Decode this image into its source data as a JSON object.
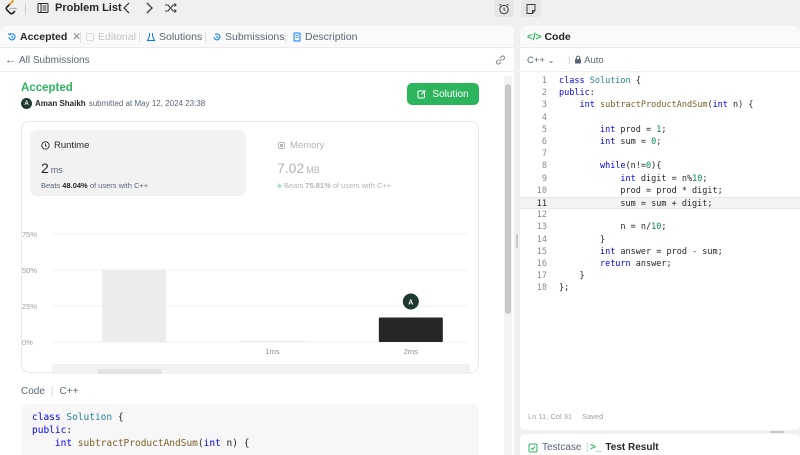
{
  "topbar": {
    "title": "Problem List",
    "icons": [
      "leetcode-logo",
      "list-icon",
      "chevron-left-icon",
      "chevron-right-icon",
      "shuffle-icon",
      "alarm-icon",
      "note-icon"
    ]
  },
  "left_tabs": [
    {
      "label": "Accepted",
      "icon": "history-icon",
      "active": true
    },
    {
      "label": "Editorial",
      "icon": "book-icon",
      "disabled": true
    },
    {
      "label": "Solutions",
      "icon": "flask-icon"
    },
    {
      "label": "Submissions",
      "icon": "history-icon"
    },
    {
      "label": "Description",
      "icon": "document-icon"
    }
  ],
  "subhead": {
    "back_label": "All Submissions"
  },
  "submission": {
    "status": "Accepted",
    "avatar_letter": "A",
    "author": "Aman Shaikh",
    "submitted_text": "submitted at May 12, 2024 23:38",
    "solution_button": "Solution"
  },
  "runtime": {
    "title": "Runtime",
    "value": "2",
    "unit": "ms",
    "beats_prefix": "Beats",
    "beats_pct": "48.04%",
    "beats_suffix": "of users with C++"
  },
  "memory": {
    "title": "Memory",
    "value": "7.02",
    "unit": "MB",
    "beats_prefix": "Beats",
    "beats_pct": "75.81%",
    "beats_suffix": "of users with C++"
  },
  "chart_data": {
    "type": "bar",
    "categories": [
      "",
      "1ms",
      "2ms"
    ],
    "values": [
      50,
      1,
      17
    ],
    "y_ticks": [
      "75%",
      "50%",
      "25%",
      "0%"
    ],
    "ylim": [
      0,
      75
    ],
    "highlight_category": "2ms",
    "marker_label": "A",
    "grid": true,
    "overview": {
      "categories": [
        "",
        "1ms",
        "2ms"
      ],
      "values": [
        50,
        1,
        17
      ]
    }
  },
  "code_header": {
    "label": "Code",
    "language": "C++"
  },
  "code_preview": [
    "class Solution {",
    "public:",
    "    int subtractProductAndSum(int n) {"
  ],
  "right_tab": {
    "label": "Code"
  },
  "editor_toolbar": {
    "language": "C++",
    "mode": "Auto"
  },
  "editor_lines": [
    {
      "n": "1",
      "code": "class Solution {"
    },
    {
      "n": "2",
      "code": "public:"
    },
    {
      "n": "3",
      "code": "    int subtractProductAndSum(int n) {"
    },
    {
      "n": "4",
      "code": ""
    },
    {
      "n": "5",
      "code": "        int prod = 1;"
    },
    {
      "n": "6",
      "code": "        int sum = 0;"
    },
    {
      "n": "7",
      "code": ""
    },
    {
      "n": "8",
      "code": "        while(n!=0){"
    },
    {
      "n": "9",
      "code": "            int digit = n%10;"
    },
    {
      "n": "10",
      "code": "            prod = prod * digit;"
    },
    {
      "n": "11",
      "code": "            sum = sum + digit;"
    },
    {
      "n": "12",
      "code": ""
    },
    {
      "n": "13",
      "code": "            n = n/10;"
    },
    {
      "n": "14",
      "code": "        }"
    },
    {
      "n": "15",
      "code": "        int answer = prod - sum;"
    },
    {
      "n": "16",
      "code": "        return answer;"
    },
    {
      "n": "17",
      "code": "    }"
    },
    {
      "n": "18",
      "code": "};"
    }
  ],
  "current_line": "11",
  "status_bar": {
    "position": "Ln 11, Col 31",
    "state": "Saved"
  },
  "bottom_tabs": [
    {
      "label": "Testcase",
      "icon": "checkbox-icon"
    },
    {
      "label": "Test Result",
      "icon": "terminal-icon",
      "active": true
    }
  ],
  "colors": {
    "accent_green": "#2db55d",
    "highlight_bar": "#262626",
    "bar_gray": "#ececec"
  }
}
